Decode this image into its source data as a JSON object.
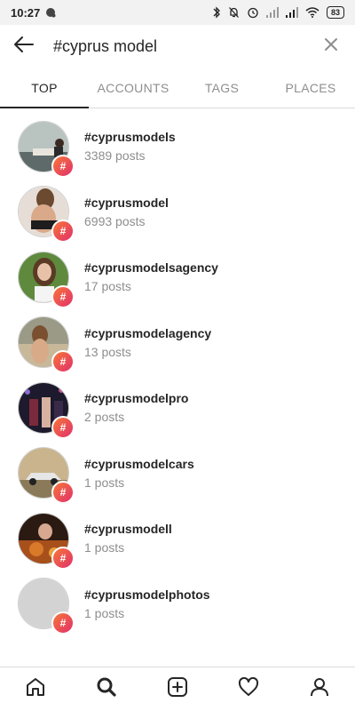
{
  "status_bar": {
    "time": "10:27",
    "battery": "83",
    "icons": [
      "chat-bubble-icon",
      "bluetooth-icon",
      "mute-bell-icon",
      "alarm-icon",
      "signal-icon",
      "signal-icon",
      "wifi-icon",
      "battery-icon"
    ]
  },
  "search": {
    "query": "#cyprus model",
    "back_icon": "arrow-left-icon",
    "clear_icon": "close-icon"
  },
  "tabs": [
    {
      "label": "TOP",
      "active": true
    },
    {
      "label": "ACCOUNTS",
      "active": false
    },
    {
      "label": "TAGS",
      "active": false
    },
    {
      "label": "PLACES",
      "active": false
    }
  ],
  "results": [
    {
      "tag": "#cyprusmodels",
      "posts": "3389 posts"
    },
    {
      "tag": "#cyprusmodel",
      "posts": "6993 posts"
    },
    {
      "tag": "#cyprusmodelsagency",
      "posts": "17 posts"
    },
    {
      "tag": "#cyprusmodelagency",
      "posts": "13 posts"
    },
    {
      "tag": "#cyprusmodelpro",
      "posts": "2 posts"
    },
    {
      "tag": "#cyprusmodelcars",
      "posts": "1 posts"
    },
    {
      "tag": "#cyprusmodell",
      "posts": "1 posts"
    },
    {
      "tag": "#cyprusmodelphotos",
      "posts": "1 posts"
    }
  ],
  "badge_symbol": "#",
  "bottom_nav": [
    "home-icon",
    "search-icon",
    "add-post-icon",
    "activity-heart-icon",
    "profile-icon"
  ],
  "colors": {
    "badge_gradient_start": "#f77737",
    "badge_gradient_end": "#e1306c",
    "text_primary": "#262626",
    "text_secondary": "#8e8e8e"
  }
}
